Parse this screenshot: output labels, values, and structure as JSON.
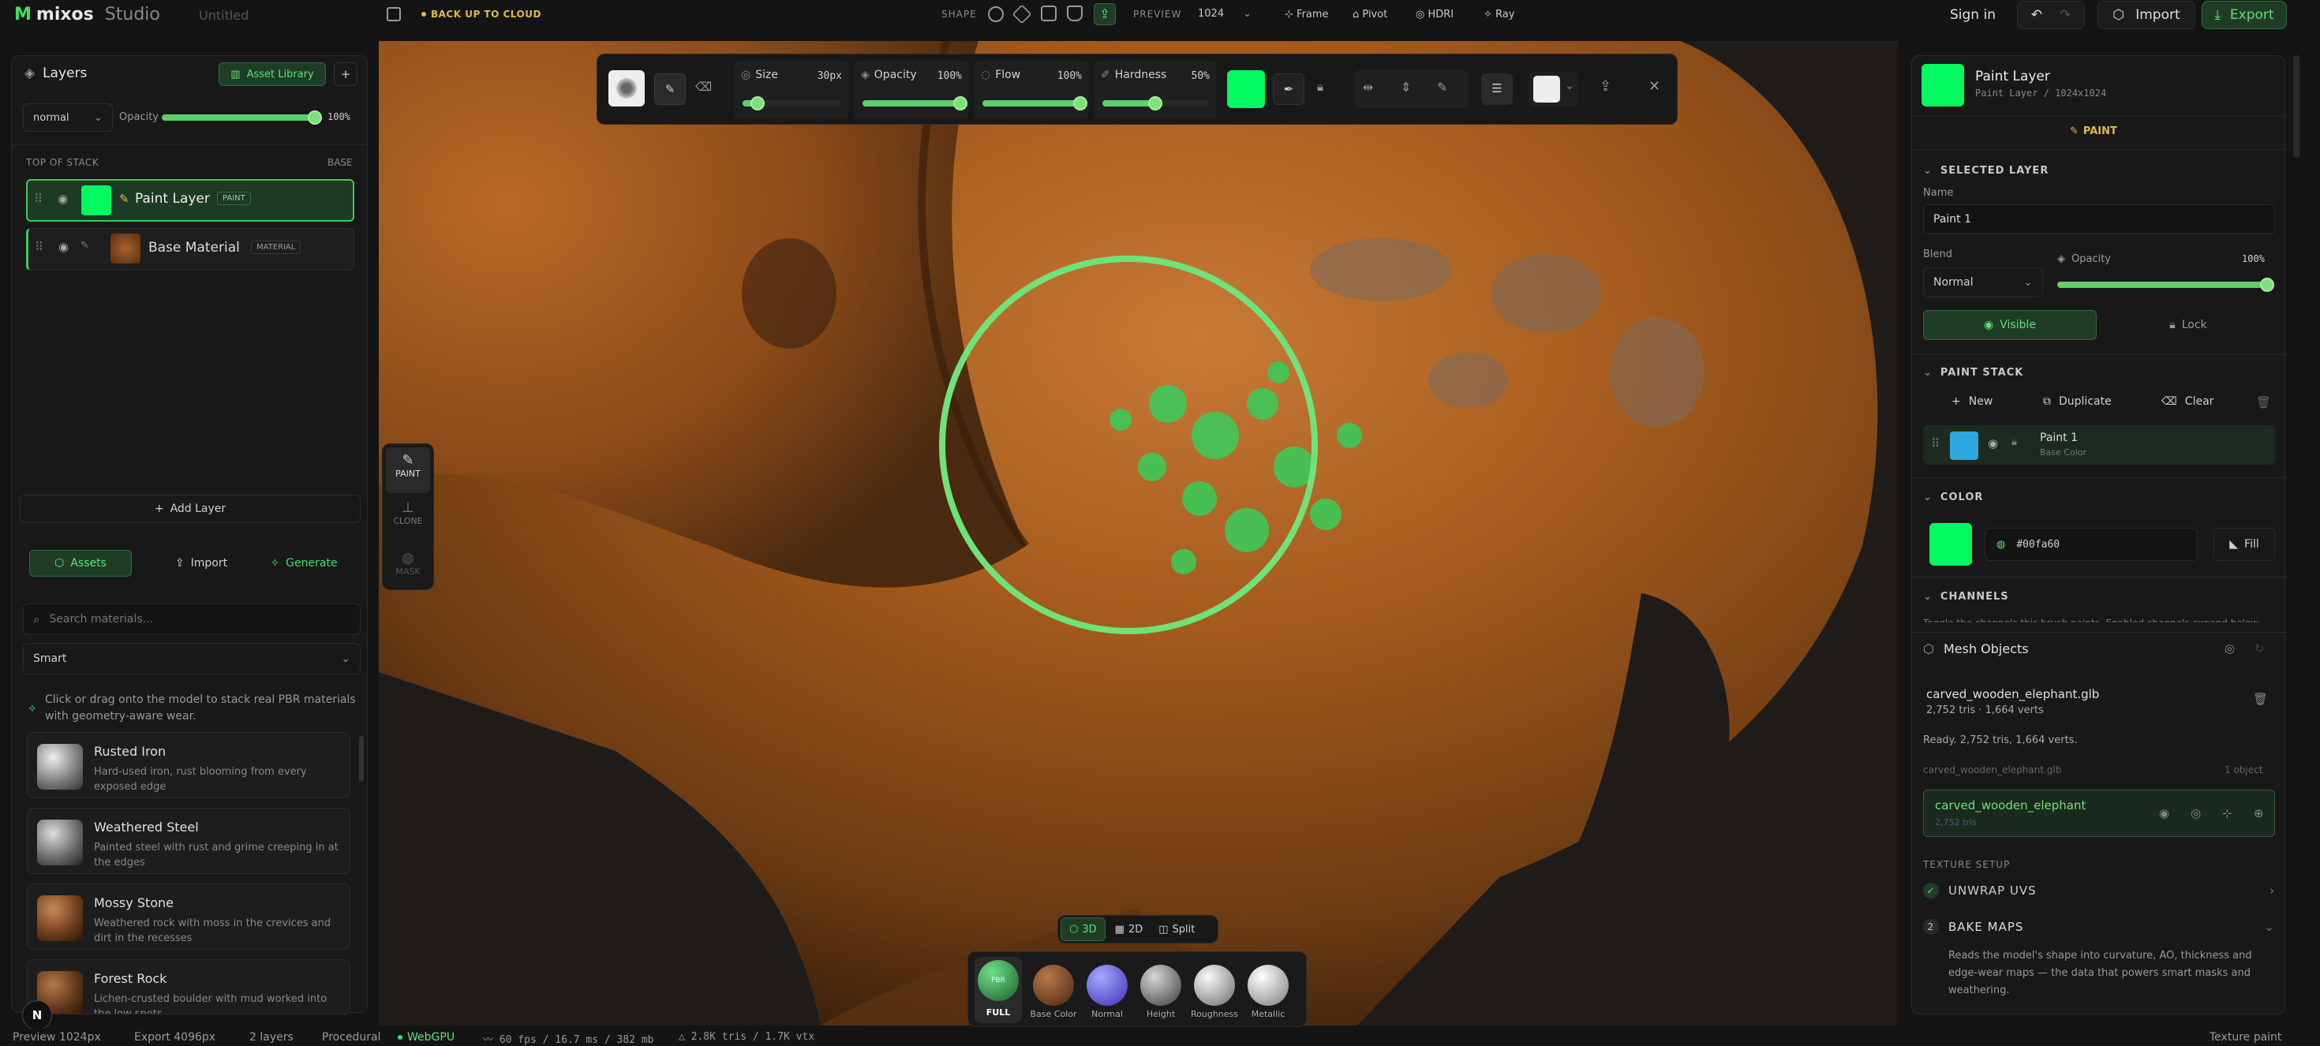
{
  "topbar": {
    "brand": "mixos",
    "studio": "Studio",
    "doc_title": "Untitled",
    "backup": "BACK UP TO CLOUD",
    "shape_label": "SHAPE",
    "preview_label": "PREVIEW",
    "preview_value": "1024",
    "frame": "Frame",
    "pivot": "Pivot",
    "hdri": "HDRI",
    "ray": "Ray",
    "sign_in": "Sign in",
    "import": "Import",
    "export": "Export"
  },
  "layers": {
    "title": "Layers",
    "asset_library": "Asset Library",
    "blend": "normal",
    "opacity_label": "Opacity",
    "opacity_value": "100%",
    "opacity": 1.0,
    "top_label": "TOP OF STACK",
    "base_label": "BASE",
    "items": [
      {
        "name": "Paint Layer",
        "badge": "PAINT"
      },
      {
        "name": "Base Material",
        "badge": "MATERIAL"
      }
    ],
    "add_layer": "Add Layer"
  },
  "assets": {
    "tabs": [
      "Assets",
      "Import",
      "Generate"
    ],
    "search_placeholder": "Search materials...",
    "filter": "Smart",
    "hint": "Click or drag onto the model to stack real PBR materials with geometry-aware wear.",
    "materials": [
      {
        "name": "Rusted Iron",
        "desc": "Hard-used iron, rust blooming from every exposed edge"
      },
      {
        "name": "Weathered Steel",
        "desc": "Painted steel with rust and grime creeping in at the edges"
      },
      {
        "name": "Mossy Stone",
        "desc": "Weathered rock with moss in the crevices and dirt in the recesses"
      },
      {
        "name": "Forest Rock",
        "desc": "Lichen-crusted boulder with mud worked into the low spots"
      }
    ]
  },
  "tools": {
    "paint": "PAINT",
    "clone": "CLONE",
    "mask": "MASK"
  },
  "brushbar": {
    "size_label": "Size",
    "size_value": "30px",
    "size": 0.15,
    "opacity_label": "Opacity",
    "opacity_value": "100%",
    "opacity": 1.0,
    "flow_label": "Flow",
    "flow_value": "100%",
    "flow": 1.0,
    "hardness_label": "Hardness",
    "hardness_value": "50%",
    "hardness": 0.5,
    "color": "#00fa60"
  },
  "viewmode": {
    "modes": [
      "3D",
      "2D",
      "Split"
    ]
  },
  "channels": [
    {
      "name": "FULL",
      "badge": "PBR"
    },
    {
      "name": "Base Color"
    },
    {
      "name": "Normal"
    },
    {
      "name": "Height"
    },
    {
      "name": "Roughness"
    },
    {
      "name": "Metallic"
    }
  ],
  "right": {
    "layer_title": "Paint Layer",
    "layer_sub": "Paint Layer / 1024x1024",
    "tab": "PAINT",
    "selected_layer": "SELECTED LAYER",
    "name_label": "Name",
    "name_value": "Paint 1",
    "blend_label": "Blend",
    "blend_value": "Normal",
    "opacity_label": "Opacity",
    "opacity_value": "100%",
    "opacity": 1.0,
    "visible": "Visible",
    "lock": "Lock",
    "paint_stack": "PAINT STACK",
    "new": "New",
    "duplicate": "Duplicate",
    "clear": "Clear",
    "stack_item": "Paint 1",
    "stack_item_sub": "Base Color",
    "color_title": "COLOR",
    "color_hex": "#00fa60",
    "fill": "Fill",
    "channels_title": "CHANNELS",
    "channels_hint": "Toggle the channels this brush paints. Enabled channels expand below."
  },
  "mesh": {
    "title": "Mesh Objects",
    "file": "carved_wooden_elephant.glb",
    "stats": "2,752 tris · 1,664 verts",
    "ready": "Ready. 2,752 tris, 1,664 verts.",
    "file2": "carved_wooden_elephant.glb",
    "count": "1 object",
    "object_name": "carved_wooden_elephant",
    "object_sub": "2,752 tris",
    "texture_setup": "TEXTURE SETUP",
    "step1": "UNWRAP UVS",
    "step2_num": "2",
    "step2": "BAKE MAPS",
    "step2_desc": "Reads the model's shape into curvature, AO, thickness and edge-wear maps — the data that powers smart masks and weathering."
  },
  "status": {
    "preview": "Preview 1024px",
    "export": "Export 4096px",
    "layers": "2 layers",
    "procedural": "Procedural",
    "webgpu": "WebGPU",
    "perf": "60 fps / 16.7 ms / 382 mb",
    "tris": "2.8K tris / 1.7K vtx",
    "mode": "Texture paint"
  },
  "colors": {
    "accent": "#3ee06a",
    "paint": "#00fa60"
  }
}
